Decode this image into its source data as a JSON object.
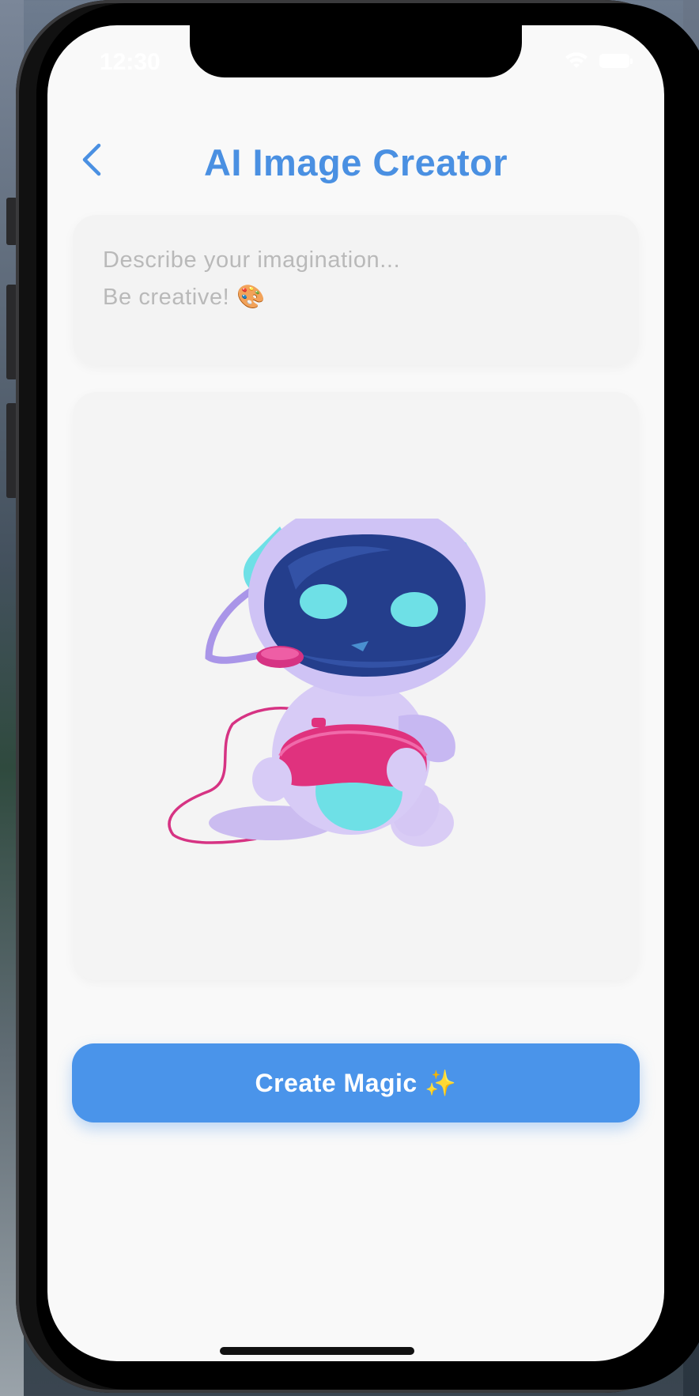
{
  "status_bar": {
    "time": "12:30",
    "icons": [
      "wifi-icon",
      "battery-icon"
    ]
  },
  "header": {
    "title": "AI Image Creator",
    "back_icon": "chevron-left-icon"
  },
  "prompt": {
    "placeholder": "Describe your imagination...\nBe creative! 🎨",
    "value": ""
  },
  "preview": {
    "illustration": "robot-gamer-illustration"
  },
  "actions": {
    "create_label": "Create Magic ✨"
  },
  "colors": {
    "accent": "#4a90e2",
    "button": "#4a94ea",
    "background": "#f9f9f9",
    "card": "#f3f3f3"
  }
}
